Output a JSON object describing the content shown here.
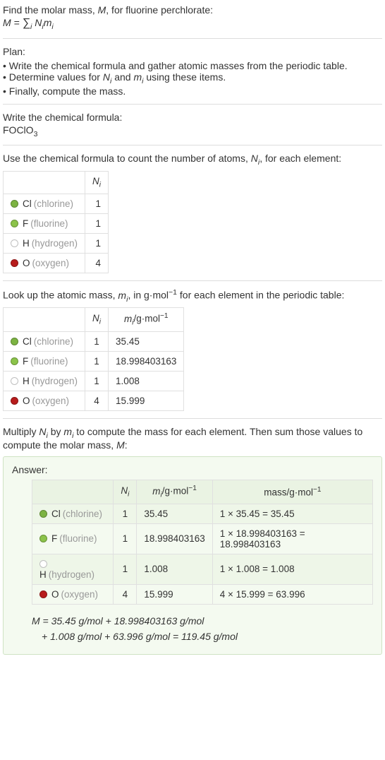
{
  "intro": {
    "line1": "Find the molar mass, M, for fluorine perchlorate:",
    "formula_html": "M = ∑<sub>i</sub> N<sub>i</sub>m<sub>i</sub>"
  },
  "plan": {
    "heading": "Plan:",
    "items": [
      "• Write the chemical formula and gather atomic masses from the periodic table.",
      "• Determine values for Nᵢ and mᵢ using these items.",
      "• Finally, compute the mass."
    ]
  },
  "formula_section": {
    "heading": "Write the chemical formula:",
    "formula": "FOClO",
    "sub": "3"
  },
  "count_section": {
    "heading_html": "Use the chemical formula to count the number of atoms, N<sub>i</sub>, for each element:",
    "col_n": "Nᵢ"
  },
  "mass_section": {
    "heading_html": "Look up the atomic mass, m<sub>i</sub>, in g·mol⁻¹ for each element in the periodic table:",
    "col_n": "Nᵢ",
    "col_m": "mᵢ/g·mol⁻¹"
  },
  "multiply_section": {
    "heading_html": "Multiply N<sub>i</sub> by m<sub>i</sub> to compute the mass for each element. Then sum those values to compute the molar mass, M:"
  },
  "elements": [
    {
      "sym": "Cl",
      "name": "(chlorine)",
      "color": "#7cb342",
      "n": 1,
      "m": "35.45",
      "mass": "1 × 35.45 = 35.45"
    },
    {
      "sym": "F",
      "name": "(fluorine)",
      "color": "#8bc34a",
      "n": 1,
      "m": "18.998403163",
      "mass": "1 × 18.998403163 = 18.998403163"
    },
    {
      "sym": "H",
      "name": "(hydrogen)",
      "color": "#ffffff",
      "n": 1,
      "m": "1.008",
      "mass": "1 × 1.008 = 1.008"
    },
    {
      "sym": "O",
      "name": "(oxygen)",
      "color": "#b71c1c",
      "n": 4,
      "m": "15.999",
      "mass": "4 × 15.999 = 63.996"
    }
  ],
  "answer": {
    "title": "Answer:",
    "col_n": "Nᵢ",
    "col_m": "mᵢ/g·mol⁻¹",
    "col_mass": "mass/g·mol⁻¹",
    "final_line1": "M = 35.45 g/mol + 18.998403163 g/mol",
    "final_line2": "+ 1.008 g/mol + 63.996 g/mol = 119.45 g/mol"
  }
}
